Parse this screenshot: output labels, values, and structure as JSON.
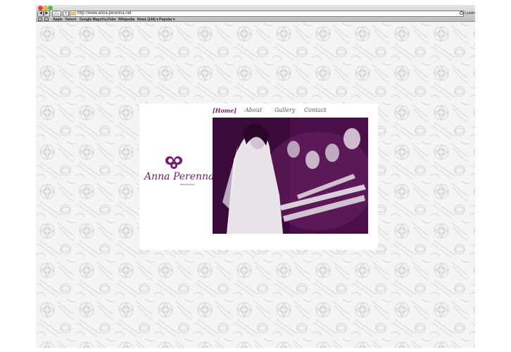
{
  "browser": {
    "url": "http://www.anna-perenna.net",
    "status": "Loadin",
    "bookmarks": [
      "Apple",
      "Yahoo!",
      "Google Maps",
      "YouTube",
      "Wikipedia",
      "News (144) ▾",
      "Popular ▾"
    ]
  },
  "site": {
    "logo_name": "Anna Perenna",
    "logo_tagline": "Bridal Boutique",
    "nav": [
      "[Home]",
      "About",
      "Gallery",
      "Contact"
    ],
    "brand_color": "#7b1a6e"
  }
}
